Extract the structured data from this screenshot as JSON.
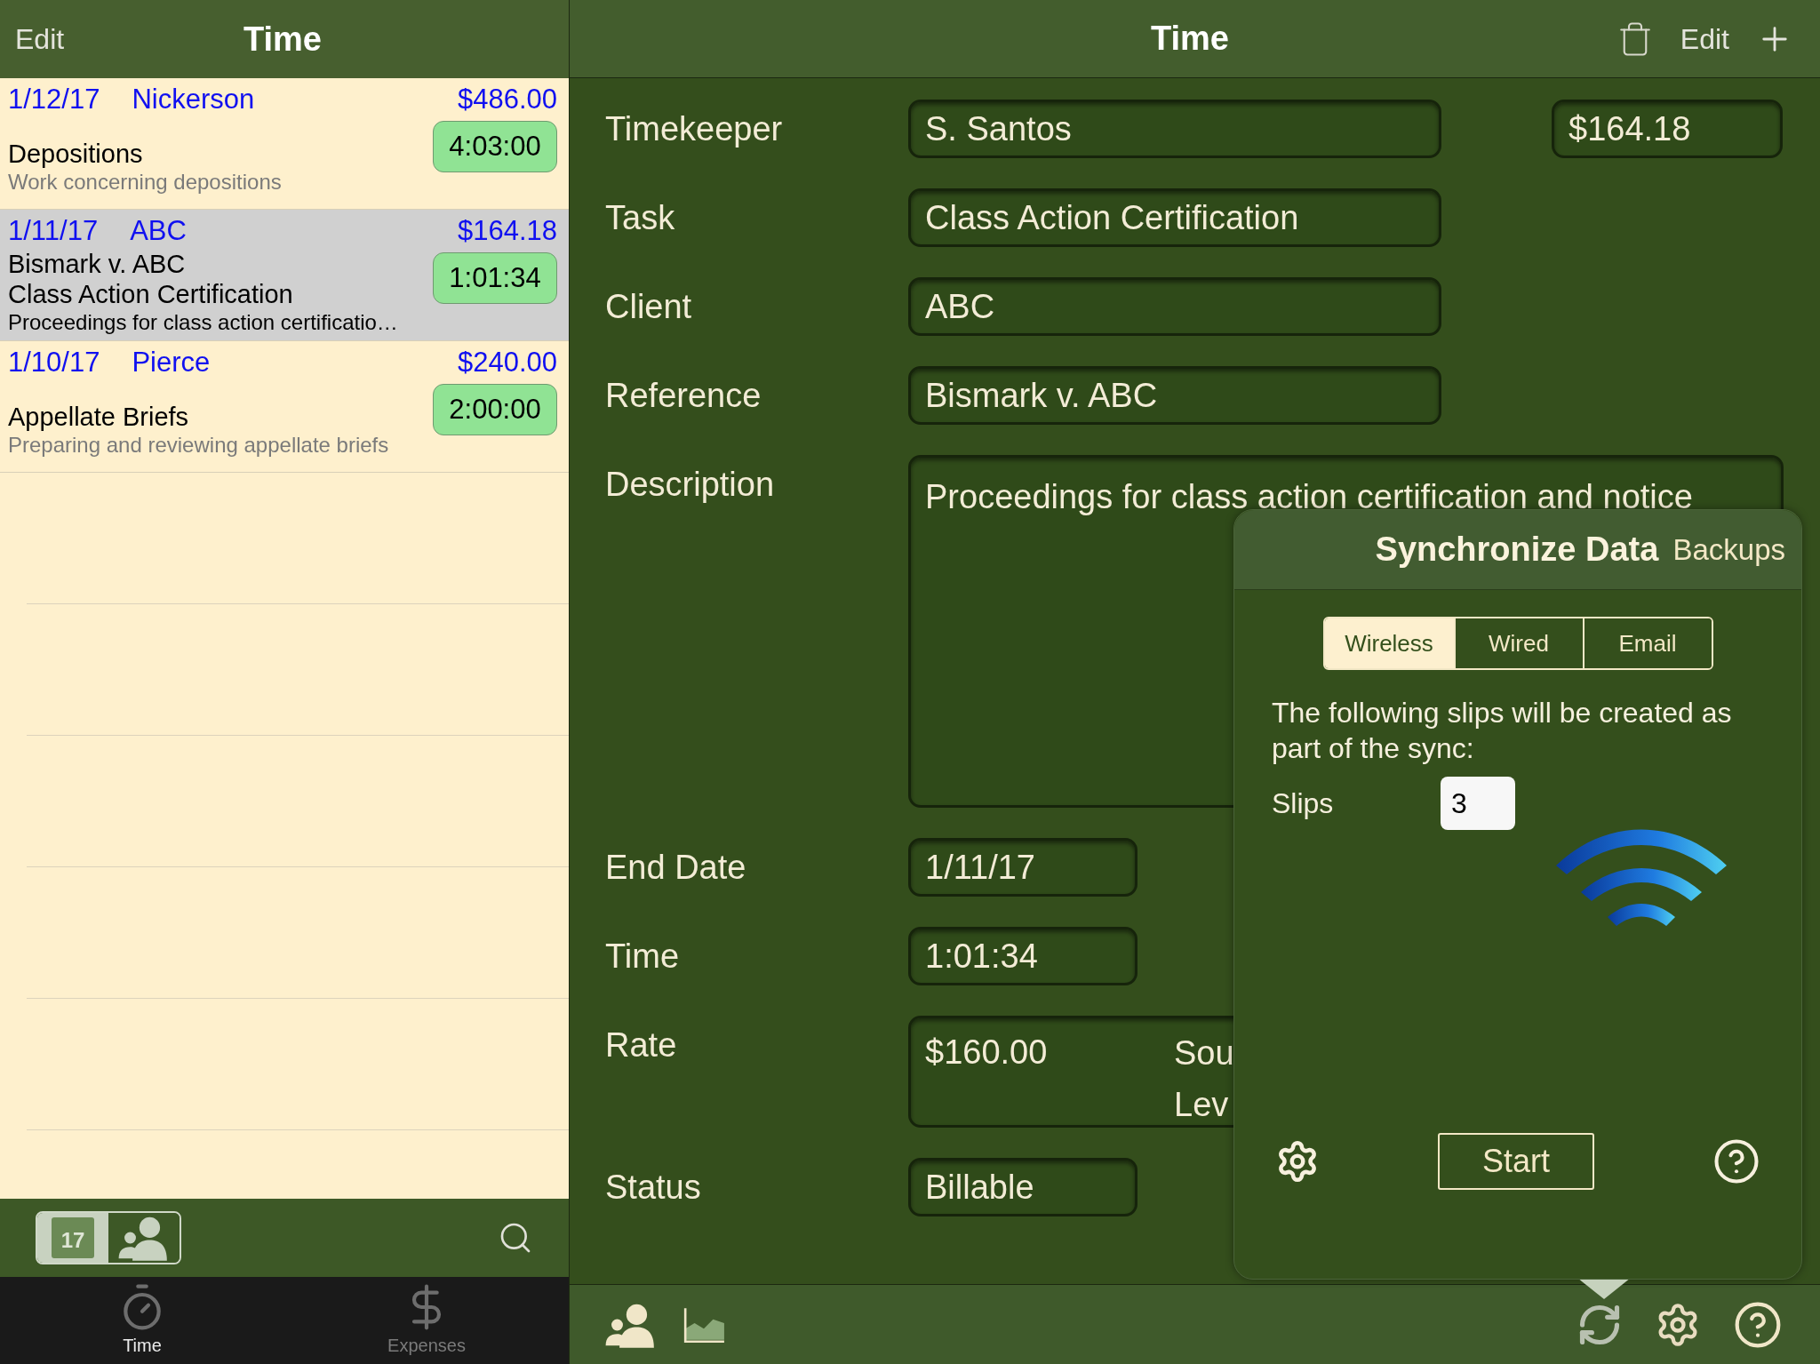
{
  "list_header": {
    "edit": "Edit",
    "title": "Time"
  },
  "slips": [
    {
      "date": "1/12/17",
      "client": "Nickerson",
      "amount": "$486.00",
      "time": "4:03:00",
      "selected": false,
      "lines": [
        {
          "kind": "spacer"
        },
        {
          "kind": "title",
          "text": "Depositions"
        },
        {
          "kind": "note",
          "text": "Work concerning depositions"
        }
      ]
    },
    {
      "date": "1/11/17",
      "client": "ABC",
      "amount": "$164.18",
      "time": "1:01:34",
      "selected": true,
      "lines": [
        {
          "kind": "title",
          "text": "Bismark v. ABC"
        },
        {
          "kind": "title",
          "text": "Class Action Certification"
        },
        {
          "kind": "detail",
          "text": "Proceedings for class action certificatio…"
        }
      ]
    },
    {
      "date": "1/10/17",
      "client": "Pierce",
      "amount": "$240.00",
      "time": "2:00:00",
      "selected": false,
      "lines": [
        {
          "kind": "spacer"
        },
        {
          "kind": "title",
          "text": "Appellate Briefs"
        },
        {
          "kind": "note",
          "text": "Preparing and reviewing appellate briefs"
        }
      ]
    }
  ],
  "view_toggle": [
    {
      "kind": "calendar",
      "label": "17",
      "selected": true
    },
    {
      "kind": "people",
      "selected": false
    }
  ],
  "tab_bar": [
    {
      "kind": "stopwatch",
      "label": "Time",
      "selected": true
    },
    {
      "kind": "dollar",
      "label": "Expenses",
      "selected": false
    }
  ],
  "detail_header": {
    "title": "Time",
    "edit": "Edit"
  },
  "amount": "$164.18",
  "fields": [
    {
      "kind": "text",
      "label": "Timekeeper",
      "value": "S. Santos"
    },
    {
      "kind": "text",
      "label": "Task",
      "value": "Class Action Certification"
    },
    {
      "kind": "text",
      "label": "Client",
      "value": "ABC"
    },
    {
      "kind": "text",
      "label": "Reference",
      "value": "Bismark v. ABC"
    },
    {
      "kind": "multiline",
      "label": "Description",
      "value": "Proceedings for class action certification and notice"
    },
    {
      "kind": "short",
      "label": "End Date",
      "value": "1/11/17"
    },
    {
      "kind": "short",
      "label": "Time",
      "value": "1:01:34"
    },
    {
      "kind": "rate",
      "label": "Rate",
      "value": "$160.00",
      "extra": [
        "Sou",
        "Lev"
      ]
    },
    {
      "kind": "short",
      "label": "Status",
      "value": "Billable"
    }
  ],
  "sync_popover": {
    "title": "Synchronize Data",
    "backups": "Backups",
    "modes": [
      {
        "label": "Wireless",
        "selected": true
      },
      {
        "label": "Wired",
        "selected": false
      },
      {
        "label": "Email",
        "selected": false
      }
    ],
    "message": "The following slips will be created as part of the sync:",
    "slips_label": "Slips",
    "slips_count": "3",
    "start": "Start"
  }
}
